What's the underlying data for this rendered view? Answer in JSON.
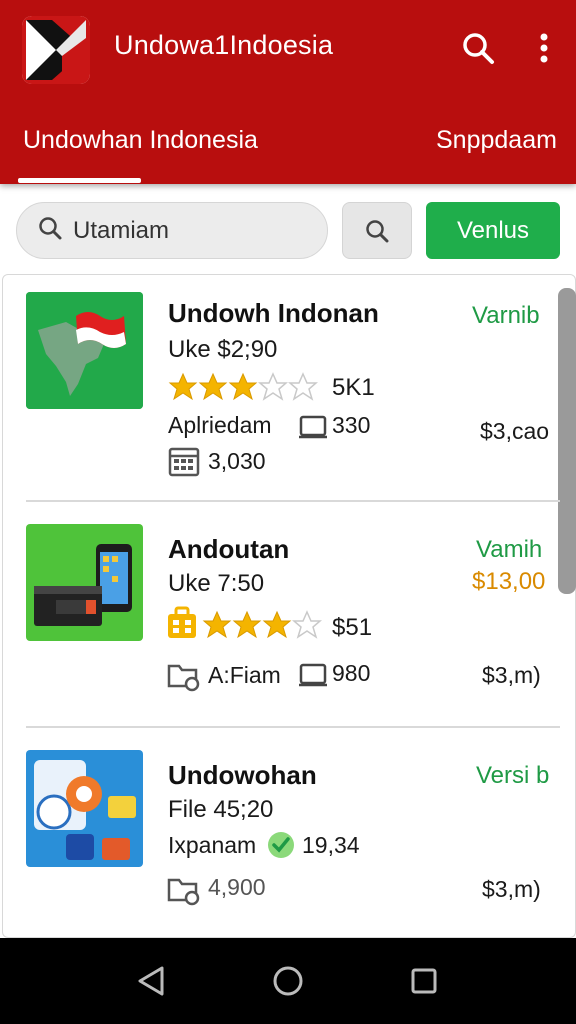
{
  "header": {
    "title": "Undowa1Indoesia",
    "tabs": [
      {
        "label": "Undowhan Indonesia"
      },
      {
        "label": "Snppdaam"
      }
    ]
  },
  "search": {
    "value": "Utamiam",
    "button_label": "Venlus"
  },
  "items": [
    {
      "name": "Undowh Indonan",
      "subtitle": "Uke $2;90",
      "rating": 3,
      "rating_count": "5K1",
      "tag": "Varnib",
      "meta_label": "Aplriedam",
      "meta_count": "330",
      "extra_count": "3,030",
      "price": "$3,cao"
    },
    {
      "name": "Andoutan",
      "subtitle": "Uke 7:50",
      "rating": 3,
      "rating_count": "$51",
      "tag": "Vamih",
      "tag_price": "$13,00",
      "meta_label": "A:Fiam",
      "meta_count": "980",
      "price": "$3,m)"
    },
    {
      "name": "Undowohan",
      "subtitle": "File 45;20",
      "meta_label": "Ixpanam",
      "meta_count": "19,34",
      "tag": "Versi b",
      "extra_count": "4,900",
      "price": "$3,m)"
    }
  ],
  "colors": {
    "appbar": "#b80e0e",
    "accent_green": "#1fae4b",
    "tag_green": "#1f9a45",
    "price_orange": "#d98a00",
    "star": "#f4b400"
  },
  "icons": [
    "app-logo-icon",
    "search-icon",
    "more-vert-icon",
    "back-nav-icon",
    "home-nav-icon",
    "recents-nav-icon"
  ]
}
